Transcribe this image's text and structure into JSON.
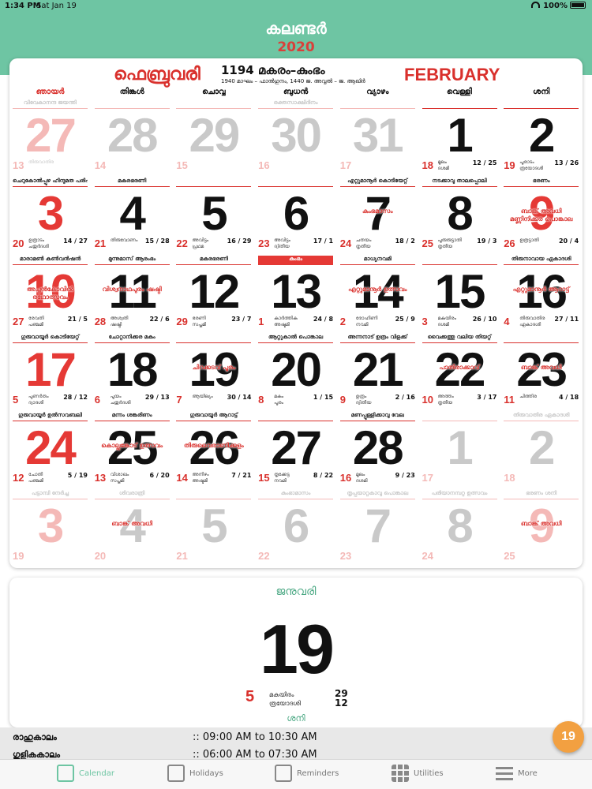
{
  "status": {
    "time": "1:34 PM",
    "date": "Sat Jan 19",
    "battery": "100%"
  },
  "header": {
    "title": "കലണ്ടർ",
    "year": "2020"
  },
  "month": {
    "mal_title": "ഫെബ്രുവരി",
    "era": "1194 മകരം–കുംഭം",
    "era_sub": "1940 മാഘം – ഫാൽഗുനം, 1440 ജ. അവ്വൽ – ജ. ആഖിർ",
    "eng_title": "FEBRUARY",
    "weekdays": [
      "ഞായർ",
      "തിങ്കൾ",
      "ചൊവ്വ",
      "ബുധൻ",
      "വ്യാഴം",
      "വെള്ളി",
      "ശനി"
    ],
    "days": [
      {
        "d": "27",
        "m": "13",
        "red": true,
        "faded": true,
        "ev": "വിവേകാനന്ദ ജയന്തി",
        "i1": "തിരുവാതിര",
        "i2": "",
        "r": ""
      },
      {
        "d": "28",
        "m": "14",
        "faded": true,
        "ev": "",
        "i1": "",
        "i2": "",
        "r": ""
      },
      {
        "d": "29",
        "m": "15",
        "faded": true,
        "ev": "",
        "i1": "",
        "i2": "",
        "r": ""
      },
      {
        "d": "30",
        "m": "16",
        "faded": true,
        "ev": "രക്തസാക്ഷിദിനം",
        "i1": "",
        "i2": "",
        "r": ""
      },
      {
        "d": "31",
        "m": "17",
        "faded": true,
        "ev": "",
        "i1": "",
        "i2": "",
        "r": ""
      },
      {
        "d": "1",
        "m": "18",
        "ev": "",
        "i1": "മൂലം",
        "i2": "ദശമി",
        "r": "12 / 25"
      },
      {
        "d": "2",
        "m": "19",
        "ev": "",
        "i1": "പൂരാടം",
        "i2": "ത്രയോദശി",
        "r": "13 / 26"
      },
      {
        "d": "3",
        "m": "20",
        "red": true,
        "ev": "ചെറുകോൽപ്പുഴ ഹിന്ദുമത പരിഷത്ത്",
        "i1": "ഉത്രാടം",
        "i2": "ചതുർദശി",
        "r": "14 / 27"
      },
      {
        "d": "4",
        "m": "21",
        "ev": "മകരഭരണി",
        "i1": "തിരുവോണം",
        "i2": "",
        "r": "15 / 28"
      },
      {
        "d": "5",
        "m": "22",
        "ev": "",
        "i1": "അവിട്ടം",
        "i2": "പ്രഥമ",
        "r": "16 / 29"
      },
      {
        "d": "6",
        "m": "23",
        "ev": "",
        "i1": "അവിട്ടം",
        "i2": "ദ്വിതീയ",
        "r": "17 / 1"
      },
      {
        "d": "7",
        "m": "24",
        "ev": "എറ്റുമാനൂർ കൊടിയേറ്റ്",
        "over": "കുംഭമാസം",
        "i1": "ചതയം",
        "i2": "തൃതീയ",
        "r": "18 / 2"
      },
      {
        "d": "8",
        "m": "25",
        "ev": "നടക്കാവു താലപ്പൊലി",
        "i1": "പൂരുരുട്ടാതി",
        "i2": "തൃതീയ",
        "r": "19 / 3"
      },
      {
        "d": "9",
        "m": "26",
        "red": true,
        "ev": "ഭരണം",
        "over": "ബാങ്ക് അവധി മണ്ണിനിക്കര പൊങ്കാല",
        "i1": "ഉത്രട്ടാതി",
        "i2": "",
        "r": "20 / 4"
      },
      {
        "d": "10",
        "m": "27",
        "red": true,
        "ev": "മാരാമൺ കൺവൻഷൻ",
        "over": "അച്ചൻകോവിൽ രഥോത്സവം",
        "i1": "രേവതി",
        "i2": "പഞ്ചമി",
        "r": "21 / 5"
      },
      {
        "d": "11",
        "m": "28",
        "ev": "മുന്നുമാസ് ആരംഭം",
        "over": "വിശ്വനാഥപുരം ഷഷ്ഠി",
        "i1": "അശ്വതി",
        "i2": "ഷഷ്ഠി",
        "r": "22 / 6"
      },
      {
        "d": "12",
        "m": "29",
        "ev": "മകരഭരണി",
        "i1": "ഭരണി",
        "i2": "സപ്തമി",
        "r": "23 / 7"
      },
      {
        "d": "13",
        "m": "1",
        "hl": true,
        "ev": "കുംഭം",
        "i1": "കാർത്തിക",
        "i2": "അഷ്ടമി",
        "r": "24 / 8"
      },
      {
        "d": "14",
        "m": "2",
        "ev": "മാധ്യനവമി",
        "over": "എറ്റുമാനൂർ ഉത്സവം",
        "i1": "രോഹിണി",
        "i2": "നവമി",
        "r": "25 / 9"
      },
      {
        "d": "15",
        "m": "3",
        "ev": "",
        "i1": "മകയിരം",
        "i2": "ദശമി",
        "r": "26 / 10"
      },
      {
        "d": "16",
        "m": "4",
        "ev": "തിരുനാവായ ഏകാദശി",
        "over": "എറ്റുമാനൂർ ആറാട്ട്",
        "i1": "തിരുവാതിര",
        "i2": "ഏകാദശി",
        "r": "27 / 11"
      },
      {
        "d": "17",
        "m": "5",
        "red": true,
        "ev": "ഗുരുവായൂർ കൊടിയേറ്റ്",
        "i1": "പുണർതം",
        "i2": "ദ്വാദശി",
        "r": "28 / 12"
      },
      {
        "d": "18",
        "m": "6",
        "ev": "ചോറ്റാനിക്കര മകം",
        "i1": "പൂയം",
        "i2": "ചതുർദശി",
        "r": "29 / 13"
      },
      {
        "d": "19",
        "m": "7",
        "ev": "",
        "over": "ചിറക്കടവ് പൂരം",
        "i1": "ആയില്യം",
        "i2": "",
        "r": "30 / 14"
      },
      {
        "d": "20",
        "m": "8",
        "ev": "ആറ്റുകാൽ പൊങ്കാല",
        "i1": "മകം",
        "i2": "പൂരം",
        "r": "1 / 15"
      },
      {
        "d": "21",
        "m": "9",
        "ev": "അന്നനാട് ഉത്രം വിളക്ക്",
        "i1": "ഉത്രം",
        "i2": "ദ്വിതീയ",
        "r": "2 / 16"
      },
      {
        "d": "22",
        "m": "10",
        "ev": "വൈക്കത്തു വലിയ തിയറ്റ്",
        "over": "പാതിരാക്കാവ്",
        "i1": "അത്തം",
        "i2": "തൃതീയ",
        "r": "3 / 17"
      },
      {
        "d": "23",
        "m": "11",
        "ev": "",
        "over": "ബാങ്ക് അവധി",
        "i1": "ചിത്തിര",
        "i2": "",
        "r": "4 / 18"
      },
      {
        "d": "24",
        "m": "12",
        "red": true,
        "ev": "ഗുരുവായൂർ ഉൽസവബലി",
        "i1": "ചോതി",
        "i2": "പഞ്ചമി",
        "r": "5 / 19"
      },
      {
        "d": "25",
        "m": "13",
        "ev": "മന്നം ശങ്കരിണം",
        "over": "കൊല്ലങ്കോട് ഉത്സവം",
        "i1": "വിശാഖം",
        "i2": "സപ്തമി",
        "r": "6 / 20"
      },
      {
        "d": "26",
        "m": "14",
        "ev": "ഗുരുവായൂർ ആറാട്ട്",
        "over": "തിരുവൈരാണിക്കുളം",
        "i1": "അനിഴം",
        "i2": "അഷ്ടമി",
        "r": "7 / 21"
      },
      {
        "d": "27",
        "m": "15",
        "ev": "",
        "i1": "തൃക്കേട്ട",
        "i2": "നവമി",
        "r": "8 / 22"
      },
      {
        "d": "28",
        "m": "16",
        "ev": "മണപ്പുള്ളിക്കാവു വേല",
        "i1": "മൂലം",
        "i2": "ദശമി",
        "r": "9 / 23"
      },
      {
        "d": "1",
        "m": "17",
        "faded": true,
        "ev": "",
        "i1": "",
        "i2": "",
        "r": ""
      },
      {
        "d": "2",
        "m": "18",
        "faded": true,
        "ev": "തിരുവാതിര ഏകാദശി",
        "i1": "",
        "i2": "",
        "r": ""
      },
      {
        "d": "3",
        "m": "19",
        "red": true,
        "faded": true,
        "ev": "പട്ടാമ്പി നേർച്ച",
        "i1": "",
        "i2": "",
        "r": ""
      },
      {
        "d": "4",
        "m": "20",
        "faded": true,
        "ev": "ശിവരാത്രി",
        "over": "ബാങ്ക് അവധി",
        "i1": "",
        "i2": "",
        "r": ""
      },
      {
        "d": "5",
        "m": "21",
        "faded": true,
        "ev": "",
        "i1": "",
        "i2": "",
        "r": ""
      },
      {
        "d": "6",
        "m": "22",
        "faded": true,
        "ev": "കുംഭാമാസം",
        "i1": "",
        "i2": "",
        "r": ""
      },
      {
        "d": "7",
        "m": "23",
        "faded": true,
        "ev": "തൃപ്പയാറ്റകാവു പൊങ്കാല",
        "i1": "",
        "i2": "",
        "r": ""
      },
      {
        "d": "8",
        "m": "24",
        "faded": true,
        "ev": "പരിയാനമ്പറ്റ ഉത്സവം",
        "i1": "",
        "i2": "",
        "r": ""
      },
      {
        "d": "9",
        "m": "25",
        "red": true,
        "faded": true,
        "ev": "ഭരണം ശനി",
        "over": "ബാങ്ക് അവധി",
        "i1": "",
        "i2": "",
        "r": ""
      }
    ]
  },
  "today": {
    "mal_month": "ജനുവരി",
    "day": "19",
    "mday": "5",
    "info1": "മകയിരം",
    "info2": "ത്രയോദശി",
    "r1": "29",
    "r2": "12",
    "weekday": "ശനി"
  },
  "timings": [
    {
      "label": "രാഹുകാലം",
      "value": ":: 09:00 AM to 10:30 AM"
    },
    {
      "label": "ഗുളികകാലം",
      "value": ":: 06:00 AM to 07:30 AM"
    }
  ],
  "fab": "19",
  "tabs": [
    "Calendar",
    "Holidays",
    "Reminders",
    "Utilities",
    "More"
  ],
  "colors": {
    "accent": "#6ec5a3",
    "red": "#d9302c",
    "orange": "#f2a041"
  }
}
